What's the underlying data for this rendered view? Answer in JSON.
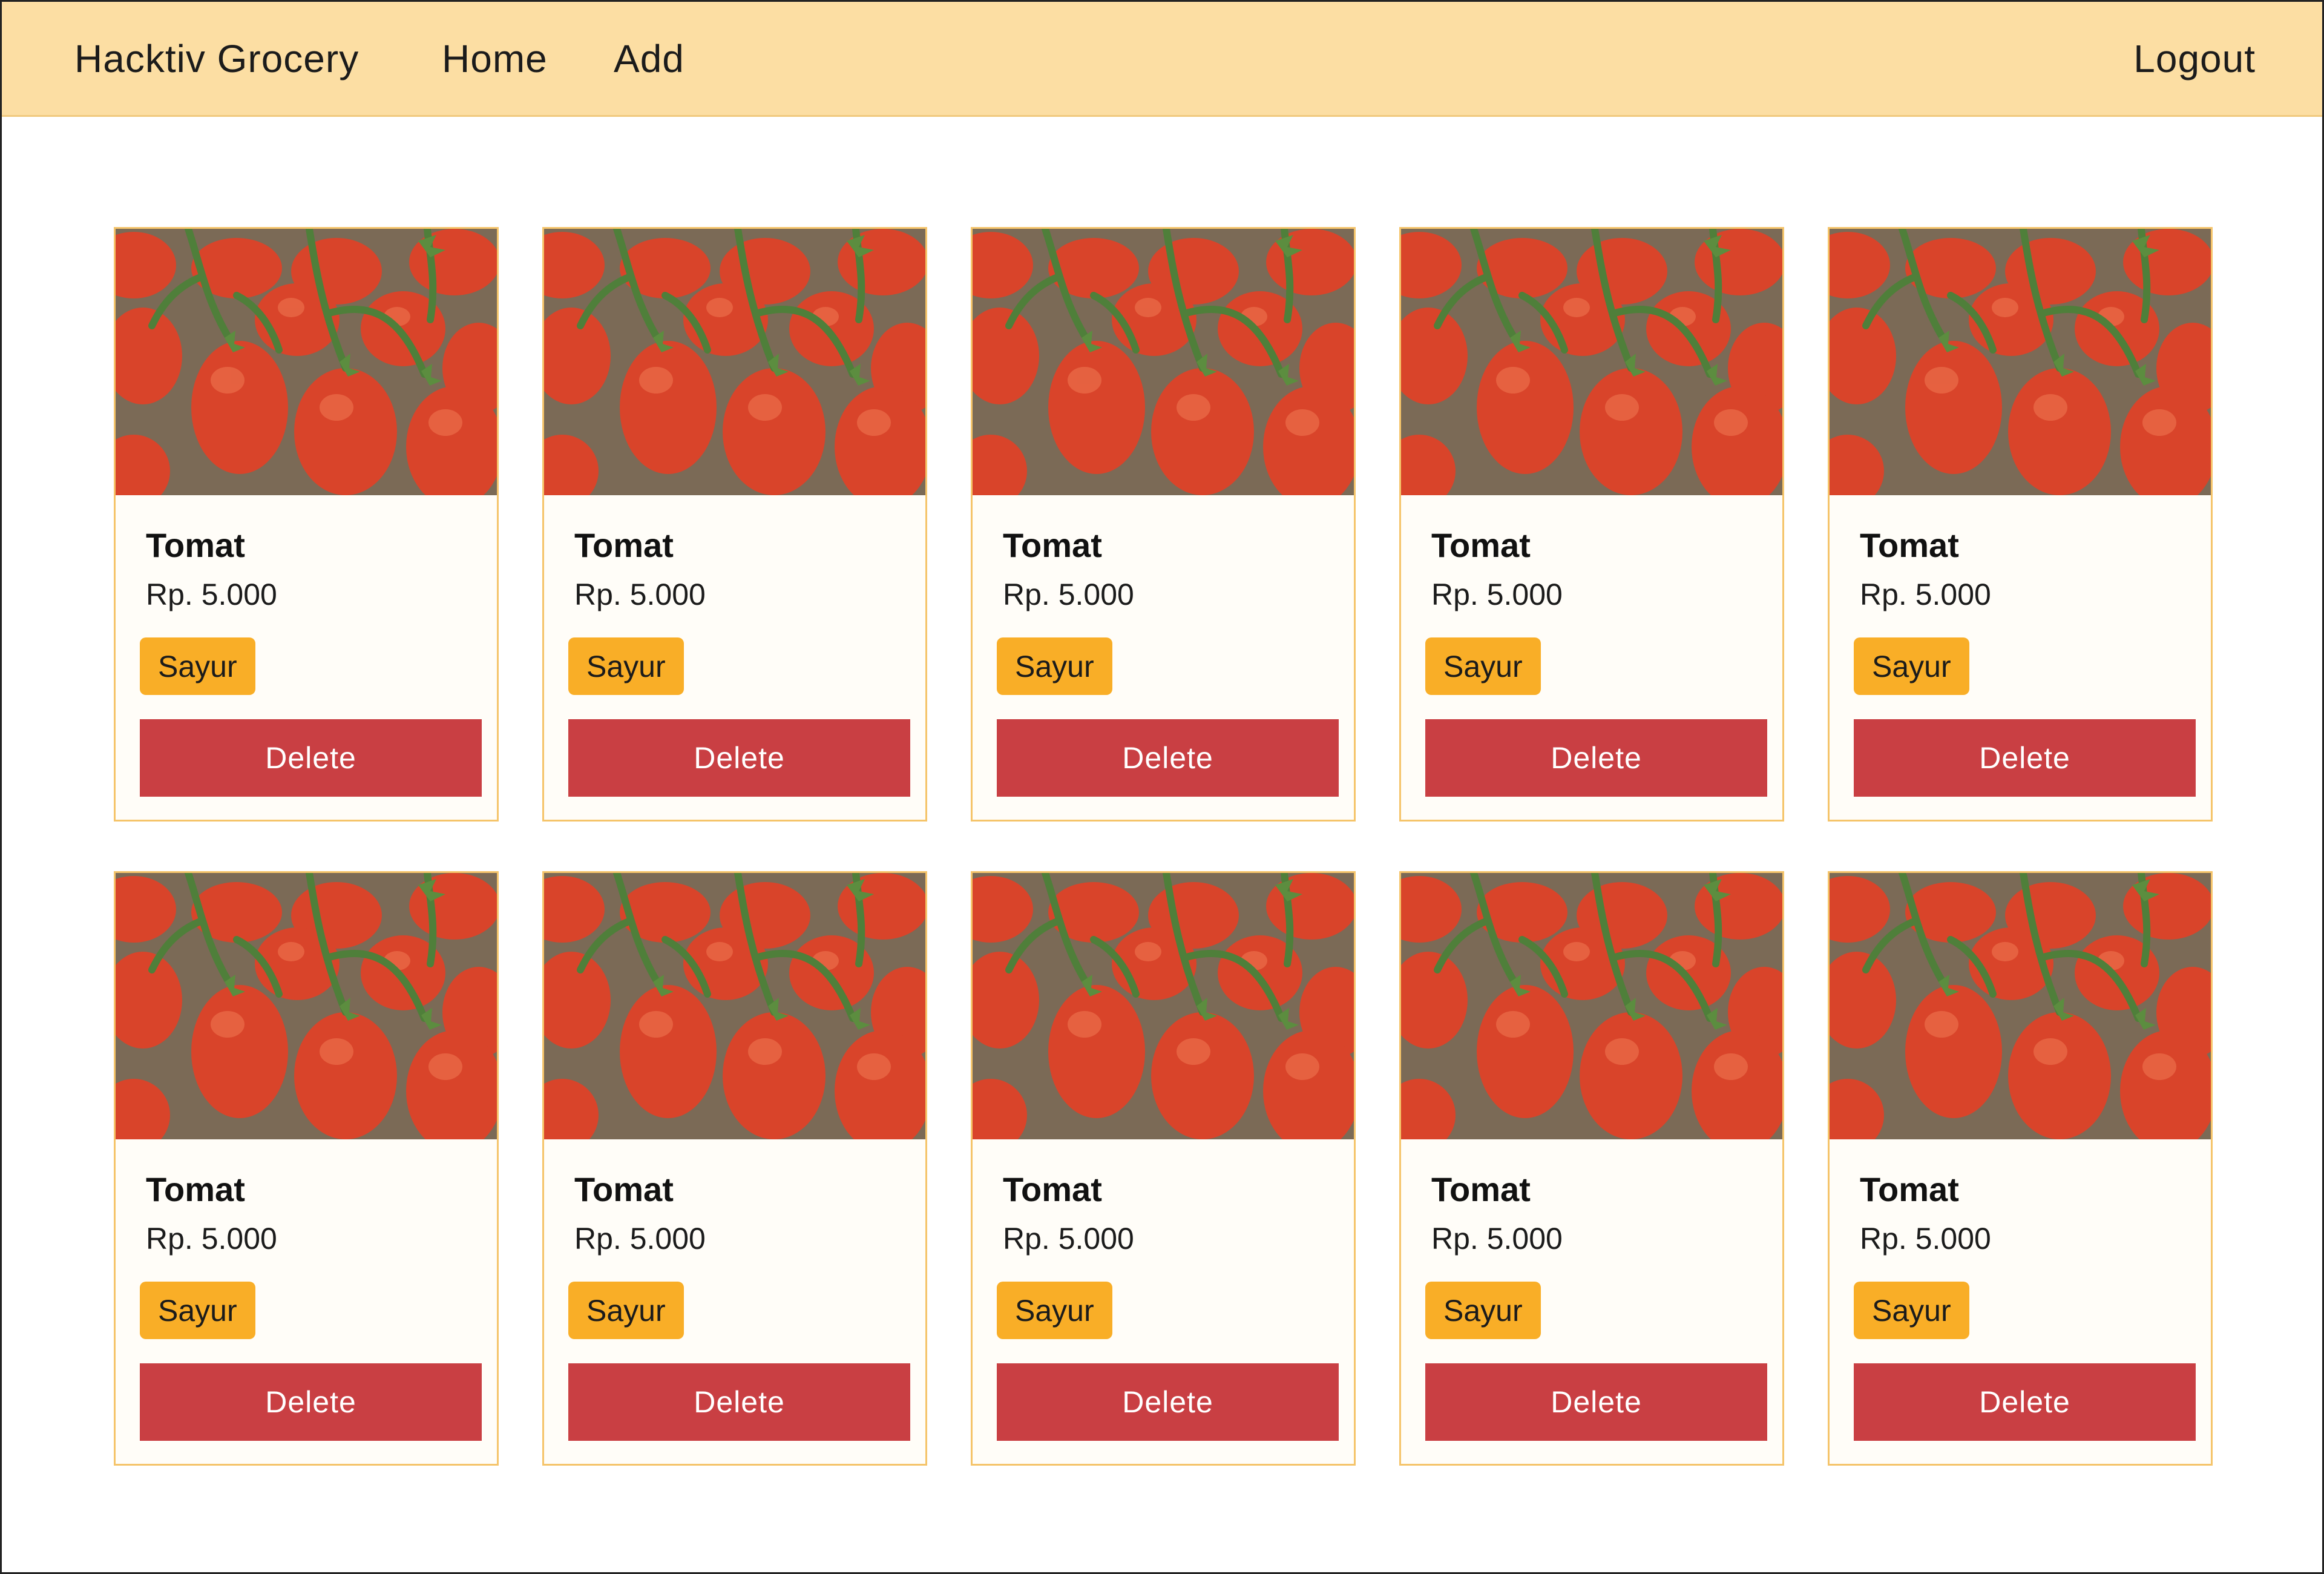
{
  "navbar": {
    "brand": "Hacktiv Grocery",
    "home_label": "Home",
    "add_label": "Add",
    "logout_label": "Logout",
    "background_color": "#fcdea3"
  },
  "products": [
    {
      "name": "Tomat",
      "price": "Rp. 5.000",
      "category": "Sayur",
      "delete_label": "Delete",
      "image": "tomatoes-photo"
    },
    {
      "name": "Tomat",
      "price": "Rp. 5.000",
      "category": "Sayur",
      "delete_label": "Delete",
      "image": "tomatoes-photo"
    },
    {
      "name": "Tomat",
      "price": "Rp. 5.000",
      "category": "Sayur",
      "delete_label": "Delete",
      "image": "tomatoes-photo"
    },
    {
      "name": "Tomat",
      "price": "Rp. 5.000",
      "category": "Sayur",
      "delete_label": "Delete",
      "image": "tomatoes-photo"
    },
    {
      "name": "Tomat",
      "price": "Rp. 5.000",
      "category": "Sayur",
      "delete_label": "Delete",
      "image": "tomatoes-photo"
    },
    {
      "name": "Tomat",
      "price": "Rp. 5.000",
      "category": "Sayur",
      "delete_label": "Delete",
      "image": "tomatoes-photo"
    },
    {
      "name": "Tomat",
      "price": "Rp. 5.000",
      "category": "Sayur",
      "delete_label": "Delete",
      "image": "tomatoes-photo"
    },
    {
      "name": "Tomat",
      "price": "Rp. 5.000",
      "category": "Sayur",
      "delete_label": "Delete",
      "image": "tomatoes-photo"
    },
    {
      "name": "Tomat",
      "price": "Rp. 5.000",
      "category": "Sayur",
      "delete_label": "Delete",
      "image": "tomatoes-photo"
    },
    {
      "name": "Tomat",
      "price": "Rp. 5.000",
      "category": "Sayur",
      "delete_label": "Delete",
      "image": "tomatoes-photo"
    }
  ],
  "colors": {
    "badge": "#f9ae27",
    "delete_button": "#c93f43",
    "card_border": "#f5c46a"
  }
}
